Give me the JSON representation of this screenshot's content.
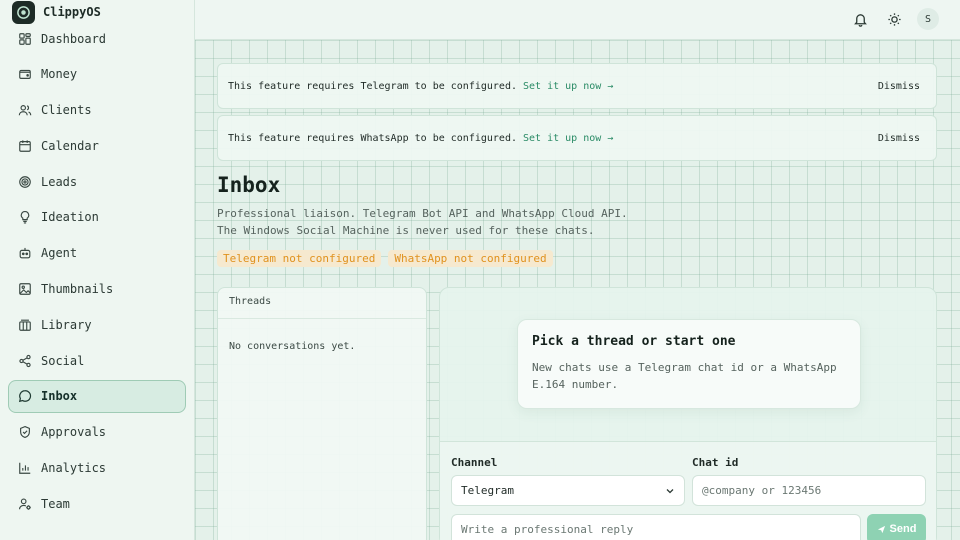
{
  "app": {
    "name": "ClippyOS"
  },
  "user": {
    "initial": "S"
  },
  "colors": {
    "accent": "#2a8b66",
    "warning": "#e0921f",
    "sidebar_active": "#d7ece2",
    "send_button": "#8ed2b3"
  },
  "sidebar": {
    "items": [
      {
        "label": "Dashboard",
        "icon": "dashboard-icon"
      },
      {
        "label": "Money",
        "icon": "wallet-icon"
      },
      {
        "label": "Clients",
        "icon": "users-icon"
      },
      {
        "label": "Calendar",
        "icon": "calendar-icon"
      },
      {
        "label": "Leads",
        "icon": "target-icon"
      },
      {
        "label": "Ideation",
        "icon": "lightbulb-icon"
      },
      {
        "label": "Agent",
        "icon": "bot-icon"
      },
      {
        "label": "Thumbnails",
        "icon": "image-icon"
      },
      {
        "label": "Library",
        "icon": "library-icon"
      },
      {
        "label": "Social",
        "icon": "share-icon"
      },
      {
        "label": "Inbox",
        "icon": "message-icon",
        "active": true
      },
      {
        "label": "Approvals",
        "icon": "shield-check-icon"
      },
      {
        "label": "Analytics",
        "icon": "bar-chart-icon"
      },
      {
        "label": "Team",
        "icon": "user-settings-icon"
      }
    ]
  },
  "banners": [
    {
      "text": "This feature requires Telegram to be configured.",
      "link": "Set it up now →",
      "dismiss": "Dismiss"
    },
    {
      "text": "This feature requires WhatsApp to be configured.",
      "link": "Set it up now →",
      "dismiss": "Dismiss"
    }
  ],
  "page": {
    "title": "Inbox",
    "subtitle_line1": "Professional liaison. Telegram Bot API and WhatsApp Cloud API.",
    "subtitle_line2": "The Windows Social Machine is never used for these chats.",
    "badges": [
      "Telegram not configured",
      "WhatsApp not configured"
    ]
  },
  "threads": {
    "header": "Threads",
    "empty": "No conversations yet."
  },
  "empty_state": {
    "title": "Pick a thread or start one",
    "text_line1": "New chats use a Telegram chat id or a WhatsApp",
    "text_line2": "E.164 number."
  },
  "composer": {
    "channel_label": "Channel",
    "channel_value": "Telegram",
    "chat_id_label": "Chat id",
    "chat_id_placeholder": "@company or 123456",
    "reply_placeholder": "Write a professional reply",
    "send_label": "Send"
  }
}
